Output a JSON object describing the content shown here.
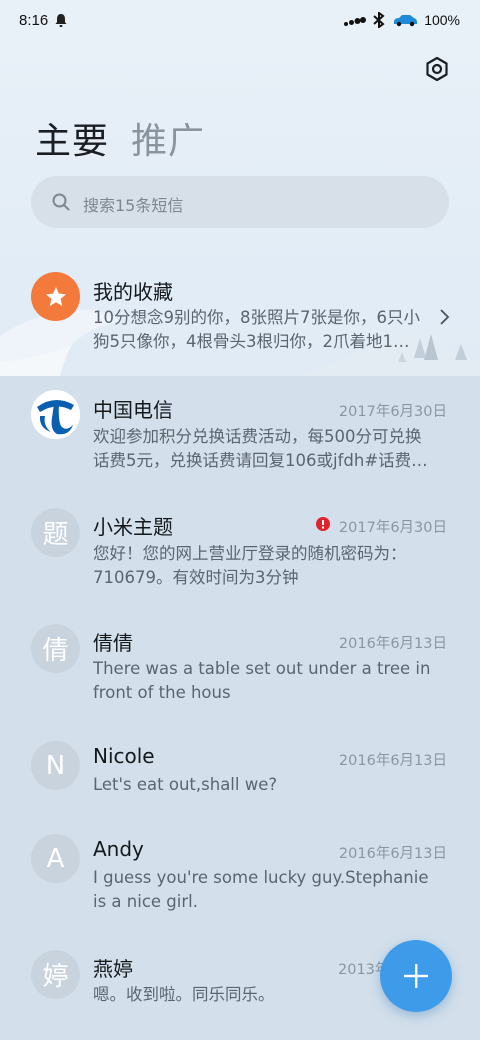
{
  "status_bar": {
    "time": "8:16",
    "battery": "100%",
    "icons": [
      "bell-icon",
      "signal-icon",
      "wifi-icon",
      "bluetooth-icon",
      "car-icon",
      "battery-text"
    ]
  },
  "header": {
    "settings_icon": "gear-icon",
    "tabs": [
      {
        "label": "主要",
        "active": true
      },
      {
        "label": "推广",
        "active": false
      }
    ]
  },
  "search": {
    "placeholder": "搜索15条短信"
  },
  "favorites": {
    "name": "我的收藏",
    "preview_line1": "10分想念9别的你，8张照片7张是你，6只小",
    "preview_line2": "狗5只像你，4根骨头3根归你，2爪着地1…"
  },
  "conversations": [
    {
      "name": "中国电信",
      "date": "2017年6月30日",
      "preview_line1": "欢迎参加积分兑换话费活动，每500分可兑换",
      "preview_line2": "话费5元，兑换话费请回复106或jfdh#话费…",
      "avatar": "telecom-logo",
      "alert": false
    },
    {
      "name": "小米主题",
      "date": "2017年6月30日",
      "preview_line1": "您好！您的网上营业厅登录的随机密码为：",
      "preview_line2": "710679。有效时间为3分钟",
      "avatar": "题",
      "alert": true
    },
    {
      "name": "倩倩",
      "date": "2016年6月13日",
      "preview_line1": "There was a table set out under a tree in",
      "preview_line2": "front of the hous",
      "avatar": "倩",
      "alert": false
    },
    {
      "name": "Nicole",
      "date": "2016年6月13日",
      "preview_line1": "Let's eat out,shall we?",
      "preview_line2": "",
      "avatar": "N",
      "alert": false
    },
    {
      "name": "Andy",
      "date": "2016年6月13日",
      "preview_line1": "I guess you're some lucky guy.Stephanie",
      "preview_line2": "is a nice girl.",
      "avatar": "A",
      "alert": false
    },
    {
      "name": "燕婷",
      "date": "2013年",
      "preview_line1": "嗯。收到啦。同乐同乐。",
      "preview_line2": "",
      "avatar": "婷",
      "alert": false
    }
  ],
  "fab": {
    "icon": "plus-icon"
  },
  "colors": {
    "accent": "#3d9be9",
    "favorite": "#f37a3b",
    "alert": "#e0242c",
    "telecom": "#0a5fb0"
  }
}
